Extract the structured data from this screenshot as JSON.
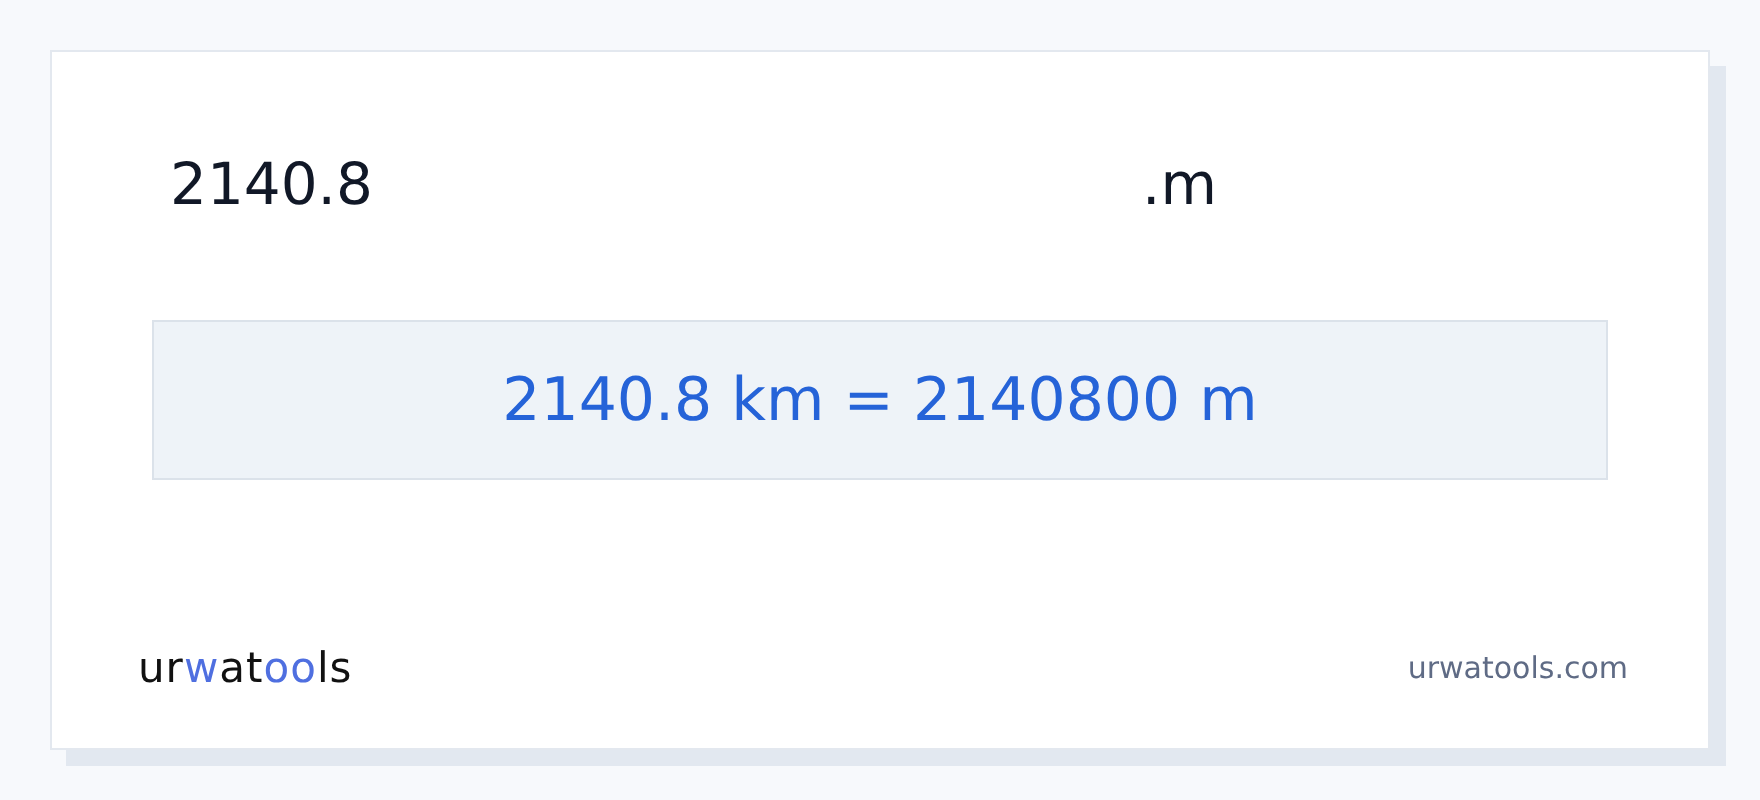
{
  "conversion": {
    "input_value": "2140.8",
    "unit_label": ".m",
    "result": "2140.8 km = 2140800 m"
  },
  "footer": {
    "logo": [
      {
        "text": "ur",
        "accent": false
      },
      {
        "text": "w",
        "accent": true
      },
      {
        "text": "at",
        "accent": false
      },
      {
        "text": "oo",
        "accent": true
      },
      {
        "text": "ls",
        "accent": false
      }
    ],
    "site": "urwatools.com"
  }
}
